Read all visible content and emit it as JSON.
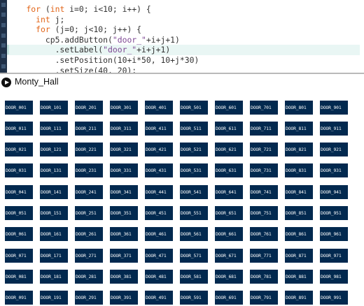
{
  "editor": {
    "code_lines": [
      [
        {
          "t": "    ",
          "c": ""
        },
        {
          "t": "for",
          "c": "kw"
        },
        {
          "t": " (",
          "c": ""
        },
        {
          "t": "int",
          "c": "kw"
        },
        {
          "t": " i=0; i<10; i++) {",
          "c": ""
        }
      ],
      [
        {
          "t": "      ",
          "c": ""
        },
        {
          "t": "int",
          "c": "kw"
        },
        {
          "t": " j;",
          "c": ""
        }
      ],
      [
        {
          "t": "      ",
          "c": ""
        },
        {
          "t": "for",
          "c": "kw"
        },
        {
          "t": " (j=0; j<10; j++) {",
          "c": ""
        }
      ],
      [
        {
          "t": "        cp5.addButton(",
          "c": ""
        },
        {
          "t": "\"door_\"",
          "c": "str"
        },
        {
          "t": "+i+j+1)",
          "c": ""
        }
      ],
      [
        {
          "t": "          .setLabel(",
          "c": ""
        },
        {
          "t": "\"door_\"",
          "c": "str"
        },
        {
          "t": "+i+j+1)",
          "c": ""
        }
      ],
      [
        {
          "t": "          .setPosition(10+i*50, 10+j*30)",
          "c": ""
        }
      ],
      [
        {
          "t": "          .setSize(40, 20);",
          "c": ""
        }
      ]
    ],
    "highlighted_line": 4
  },
  "sketch": {
    "title": "Monty_Hall"
  },
  "doors": [
    [
      "DOOR_001",
      "DOOR_011",
      "DOOR_021",
      "DOOR_031",
      "DOOR_041",
      "DOOR_051",
      "DOOR_061",
      "DOOR_071",
      "DOOR_081",
      "DOOR_091"
    ],
    [
      "DOOR_101",
      "DOOR_111",
      "DOOR_121",
      "DOOR_131",
      "DOOR_141",
      "DOOR_151",
      "DOOR_161",
      "DOOR_171",
      "DOOR_181",
      "DOOR_191"
    ],
    [
      "DOOR_201",
      "DOOR_211",
      "DOOR_221",
      "DOOR_231",
      "DOOR_241",
      "DOOR_251",
      "DOOR_261",
      "DOOR_271",
      "DOOR_281",
      "DOOR_291"
    ],
    [
      "DOOR_301",
      "DOOR_311",
      "DOOR_321",
      "DOOR_331",
      "DOOR_341",
      "DOOR_351",
      "DOOR_361",
      "DOOR_371",
      "DOOR_381",
      "DOOR_391"
    ],
    [
      "DOOR_401",
      "DOOR_411",
      "DOOR_421",
      "DOOR_431",
      "DOOR_441",
      "DOOR_451",
      "DOOR_461",
      "DOOR_471",
      "DOOR_481",
      "DOOR_491"
    ],
    [
      "DOOR_501",
      "DOOR_511",
      "DOOR_521",
      "DOOR_531",
      "DOOR_541",
      "DOOR_551",
      "DOOR_561",
      "DOOR_571",
      "DOOR_581",
      "DOOR_591"
    ],
    [
      "DOOR_601",
      "DOOR_611",
      "DOOR_621",
      "DOOR_631",
      "DOOR_641",
      "DOOR_651",
      "DOOR_661",
      "DOOR_671",
      "DOOR_681",
      "DOOR_691"
    ],
    [
      "DOOR_701",
      "DOOR_711",
      "DOOR_721",
      "DOOR_731",
      "DOOR_741",
      "DOOR_751",
      "DOOR_761",
      "DOOR_771",
      "DOOR_781",
      "DOOR_791"
    ],
    [
      "DOOR_801",
      "DOOR_811",
      "DOOR_821",
      "DOOR_831",
      "DOOR_841",
      "DOOR_851",
      "DOOR_861",
      "DOOR_871",
      "DOOR_881",
      "DOOR_891"
    ],
    [
      "DOOR_901",
      "DOOR_911",
      "DOOR_921",
      "DOOR_931",
      "DOOR_941",
      "DOOR_951",
      "DOOR_961",
      "DOOR_971",
      "DOOR_981",
      "DOOR_991"
    ]
  ],
  "colors": {
    "door_fill": "#02294f",
    "door_label": "#ffffff",
    "keyword": "#e2661a",
    "string": "#7d4793",
    "gutter": "#1f3047"
  }
}
